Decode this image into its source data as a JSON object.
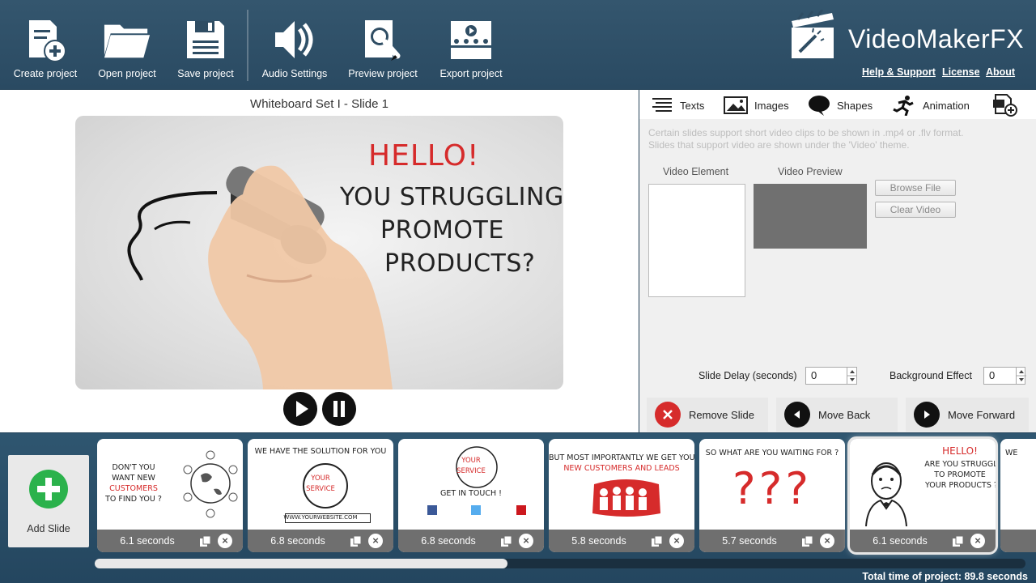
{
  "toolbar": {
    "create": "Create project",
    "open": "Open project",
    "save": "Save project",
    "audio": "Audio Settings",
    "preview": "Preview project",
    "export": "Export project"
  },
  "brand": {
    "name": "VideoMakerFX"
  },
  "links": {
    "help": "Help & Support",
    "license": "License",
    "about": "About"
  },
  "preview": {
    "title": "Whiteboard Set I - Slide  1",
    "hello": "HELLO!",
    "line1": "YOU STRUGGLING",
    "line2": "PROMOTE",
    "line3": "PRODUCTS?"
  },
  "tabs": [
    {
      "label": "Texts"
    },
    {
      "label": "Images"
    },
    {
      "label": "Shapes"
    },
    {
      "label": "Animation"
    }
  ],
  "video": {
    "hint1": "Certain slides support short video clips to be shown in .mp4 or .flv format.",
    "hint2": "Slides that support video are shown under the 'Video' theme.",
    "element_label": "Video Element",
    "preview_label": "Video Preview",
    "browse": "Browse File",
    "clear": "Clear Video"
  },
  "settings": {
    "delay_label": "Slide Delay (seconds)",
    "delay_value": "0",
    "bg_label": "Background Effect",
    "bg_value": "0"
  },
  "actions": {
    "remove": "Remove Slide",
    "back": "Move Back",
    "forward": "Move Forward"
  },
  "timeline": {
    "add_slide": "Add Slide",
    "total": "Total time of project: 89.8 seconds",
    "slides": [
      {
        "duration": "6.1 seconds",
        "lines": [
          "DON'T YOU",
          "WANT NEW",
          "CUSTOMERS",
          "TO FIND YOU ?"
        ]
      },
      {
        "duration": "6.8 seconds",
        "lines": [
          "WE HAVE THE SOLUTION FOR YOU",
          "YOUR",
          "SERVICE",
          "WWW.YOURWEBSITE.COM"
        ]
      },
      {
        "duration": "6.8 seconds",
        "lines": [
          "YOUR",
          "SERVICE",
          "GET IN TOUCH !"
        ]
      },
      {
        "duration": "5.8 seconds",
        "lines": [
          "BUT MOST IMPORTANTLY WE GET YOU",
          "NEW CUSTOMERS AND LEADS"
        ]
      },
      {
        "duration": "5.7 seconds",
        "lines": [
          "SO WHAT ARE YOU WAITING FOR ?",
          "???"
        ]
      },
      {
        "duration": "6.1 seconds",
        "lines": [
          "HELLO!",
          "ARE YOU STRUGGLING",
          "TO PROMOTE",
          "YOUR PRODUCTS ?"
        ]
      }
    ],
    "partial": "WE"
  },
  "colors": {
    "accent_red": "#d62b2b",
    "add_green": "#2bb24c",
    "toolbar_bg": "#2f4d63"
  }
}
